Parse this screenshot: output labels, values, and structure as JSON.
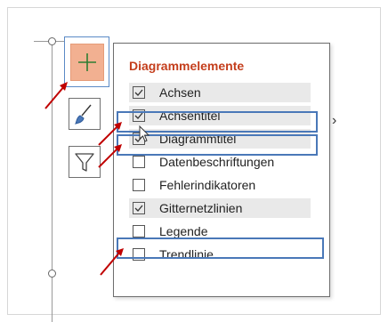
{
  "panel": {
    "title": "Diagrammelemente",
    "items": [
      {
        "label": "Achsen",
        "checked": true
      },
      {
        "label": "Achsentitel",
        "checked": true
      },
      {
        "label": "Diagrammtitel",
        "checked": true
      },
      {
        "label": "Datenbeschriftungen",
        "checked": false
      },
      {
        "label": "Fehlerindikatoren",
        "checked": false
      },
      {
        "label": "Gitternetzlinien",
        "checked": true
      },
      {
        "label": "Legende",
        "checked": false
      },
      {
        "label": "Trendlinie",
        "checked": false
      }
    ],
    "submenu_glyph": "›"
  },
  "buttons": {
    "add_icon": "plus-icon",
    "style_icon": "brush-icon",
    "filter_icon": "filter-icon"
  },
  "colors": {
    "title": "#c43e1c",
    "add_button_fill": "#f2b091",
    "highlight_border": "#4a78b8",
    "arrow": "#c00000"
  }
}
